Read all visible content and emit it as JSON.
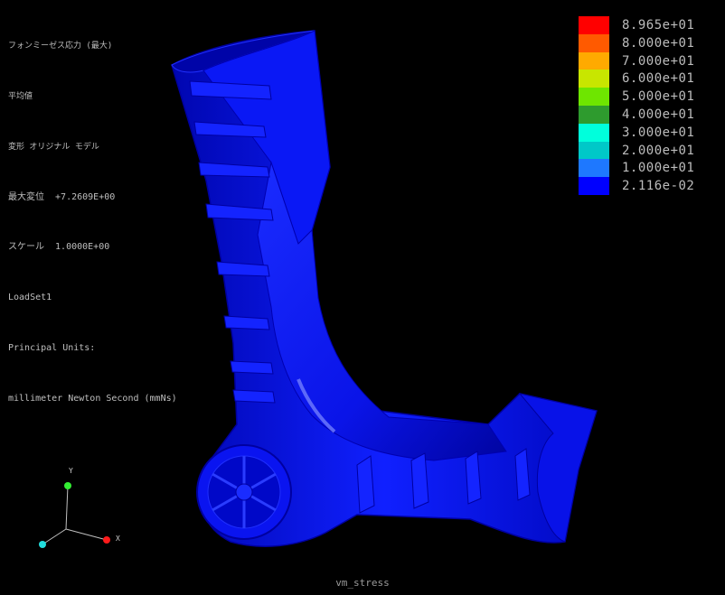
{
  "header_info": {
    "result_name": "フォンミーゼス応力 (最大)",
    "average": "平均値",
    "deformation": "変形 オリジナル モデル",
    "max_displacement": "最大変位  +7.2609E+00",
    "scale": "スケール  1.0000E+00",
    "loadset": "LoadSet1",
    "units_label": "Principal Units:",
    "units_value": "millimeter Newton Second (mmNs)"
  },
  "legend": [
    {
      "label": "8.965e+01",
      "color": "#ff0000"
    },
    {
      "label": "8.000e+01",
      "color": "#ff5a00"
    },
    {
      "label": "7.000e+01",
      "color": "#ffaa00"
    },
    {
      "label": "6.000e+01",
      "color": "#c8e600"
    },
    {
      "label": "5.000e+01",
      "color": "#6ee600"
    },
    {
      "label": "4.000e+01",
      "color": "#2e9b2e"
    },
    {
      "label": "3.000e+01",
      "color": "#00ffdc"
    },
    {
      "label": "2.000e+01",
      "color": "#00c8c8"
    },
    {
      "label": "1.000e+01",
      "color": "#1e78ff"
    },
    {
      "label": "2.116e-02",
      "color": "#0000ff"
    }
  ],
  "axes": {
    "x": "X",
    "y": "Y",
    "x_color": "#ff1a1a",
    "y_color": "#33ee33",
    "z_color": "#22dddd"
  },
  "footer": {
    "title": "vm_stress"
  },
  "colors": {
    "background": "#000000",
    "model": "#0a10e0",
    "model_dark": "#0008a0",
    "model_light": "#4050ff"
  }
}
